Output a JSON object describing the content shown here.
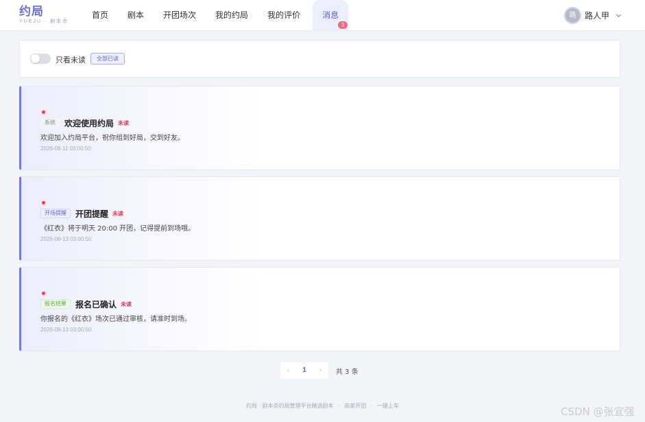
{
  "header": {
    "logo_main": "约局",
    "logo_sub": "YUEJU · 剧本杀",
    "nav": [
      {
        "label": "首页"
      },
      {
        "label": "剧本"
      },
      {
        "label": "开团场次"
      },
      {
        "label": "我的约局"
      },
      {
        "label": "我的评价"
      },
      {
        "label": "消息",
        "badge": "3"
      }
    ],
    "user": {
      "avatar_text": "路",
      "name": "路人甲"
    }
  },
  "filter": {
    "unread_only_label": "只看未读",
    "unread_only_on": false,
    "mark_all_label": "全部已读"
  },
  "messages": [
    {
      "tag": "系统",
      "title": "欢迎使用约局",
      "status": "未读",
      "body": "欢迎加入约局平台，祝你组到好局，交到好友。",
      "time": "2026-08-11 03:00:50"
    },
    {
      "tag": "开场提醒",
      "title": "开团提醒",
      "status": "未读",
      "body": "《红衣》将于明天 20:00 开团，记得提前到场哦。",
      "time": "2026-08-13 03:00:50"
    },
    {
      "tag": "报名结果",
      "title": "报名已确认",
      "status": "未读",
      "body": "你报名的《红衣》场次已通过审核，请准时到场。",
      "time": "2026-08-13 03:00:50"
    }
  ],
  "pagination": {
    "prev": "‹",
    "current": "1",
    "next": "›",
    "total_text": "共 3 条"
  },
  "footer": {
    "items": [
      "约局 · 剧本杀约局管理平台精选剧本",
      "·",
      "商家开团",
      "·",
      "一键上车"
    ]
  },
  "watermark": "CSDN @张宜强",
  "colors": {
    "accent": "#6165d6",
    "unread": "#e8344e",
    "badge": "#ee6b7d"
  }
}
